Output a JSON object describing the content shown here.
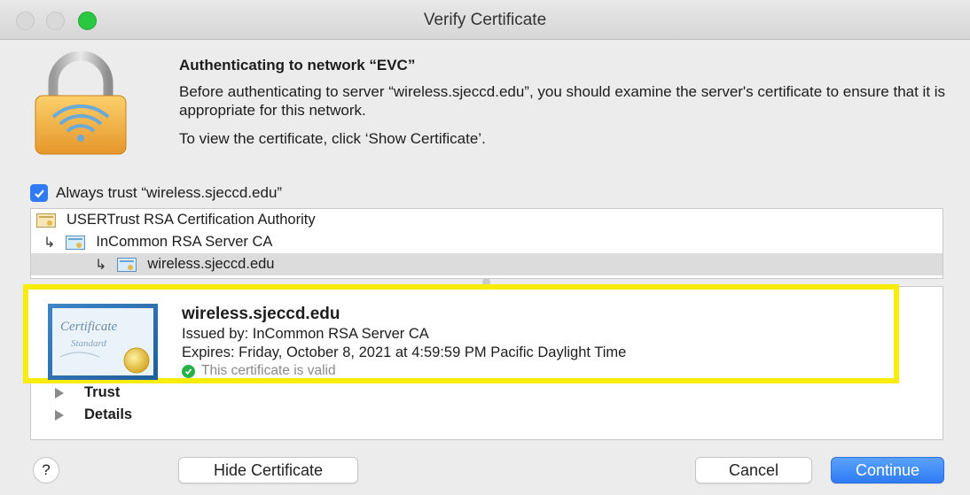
{
  "window": {
    "title": "Verify Certificate"
  },
  "header": {
    "heading": "Authenticating to network “EVC”",
    "description": "Before authenticating to server “wireless.sjeccd.edu”, you should examine the server's certificate to ensure that it is appropriate for this network.",
    "instruction": "To view the certificate, click ‘Show Certificate’."
  },
  "trust": {
    "checked": true,
    "label": "Always trust “wireless.sjeccd.edu”"
  },
  "chain": [
    {
      "label": "USERTrust RSA Certification Authority",
      "arrow": ""
    },
    {
      "label": "InCommon RSA Server CA",
      "arrow": "↳"
    },
    {
      "label": "wireless.sjeccd.edu",
      "arrow": "↳"
    }
  ],
  "certificate": {
    "name": "wireless.sjeccd.edu",
    "issued_by": "Issued by: InCommon RSA Server CA",
    "expires": "Expires: Friday, October 8, 2021 at 4:59:59 PM Pacific Daylight Time",
    "status": "This certificate is valid",
    "image_text_1": "Certificate",
    "image_text_2": "Standard"
  },
  "sections": {
    "trust": "Trust",
    "details": "Details"
  },
  "buttons": {
    "help": "?",
    "hide_certificate": "Hide Certificate",
    "cancel": "Cancel",
    "continue": "Continue"
  },
  "colors": {
    "highlight": "#f8ec0a",
    "accent": "#2f7bf5",
    "valid": "#27b14a"
  }
}
